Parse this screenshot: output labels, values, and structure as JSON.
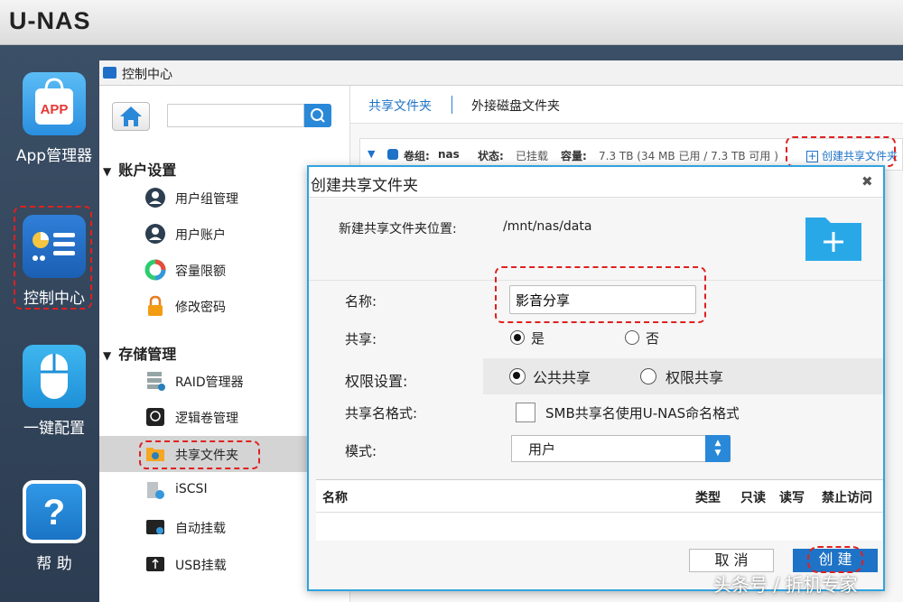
{
  "brand": "U-NAS",
  "desktop": {
    "icons": [
      {
        "label": "App管理器",
        "badge": "APP"
      },
      {
        "label": "控制中心"
      },
      {
        "label": "一键配置"
      },
      {
        "label": "帮 助",
        "glyph": "?"
      }
    ]
  },
  "control_window": {
    "title": "控制中心",
    "search_placeholder": "",
    "sections": [
      {
        "label": "账户设置",
        "items": [
          "用户组管理",
          "用户账户",
          "容量限额",
          "修改密码"
        ]
      },
      {
        "label": "存储管理",
        "items": [
          "RAID管理器",
          "逻辑卷管理",
          "共享文件夹",
          "iSCSI",
          "自动挂载",
          "USB挂载"
        ]
      }
    ],
    "active_item": "共享文件夹"
  },
  "right_panel": {
    "tabs": [
      "共享文件夹",
      "外接磁盘文件夹"
    ],
    "volume": {
      "name_label": "卷组:",
      "name": "nas",
      "status_label": "状态:",
      "status": "已挂载",
      "capacity_label": "容量:",
      "capacity": "7.3 TB (34 MB 已用 / 7.3 TB 可用 )"
    },
    "create_link": "创建共享文件夹"
  },
  "dialog": {
    "title": "创建共享文件夹",
    "location_label": "新建共享文件夹位置:",
    "location_value": "/mnt/nas/data",
    "name_label": "名称:",
    "name_value": "影音分享",
    "share_label": "共享:",
    "share_yes": "是",
    "share_no": "否",
    "perm_label": "权限设置:",
    "perm_public": "公共共享",
    "perm_private": "权限共享",
    "format_label": "共享名格式:",
    "format_checkbox": "SMB共享名使用U-NAS命名格式",
    "mode_label": "模式:",
    "mode_value": "用户",
    "table_headers": [
      "名称",
      "类型",
      "只读",
      "读写",
      "禁止访问"
    ],
    "cancel": "取 消",
    "create": "创 建"
  },
  "watermark": "头条号 / 折机专家",
  "colors": {
    "accent": "#1e73c7",
    "highlight": "#e02020",
    "dialog_border": "#2fa3e0"
  }
}
